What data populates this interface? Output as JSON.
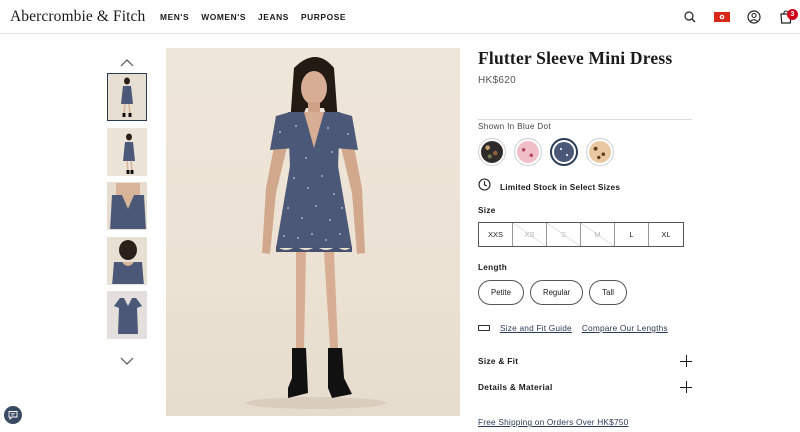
{
  "header": {
    "logo": "Abercrombie & Fitch",
    "nav": [
      "MEN'S",
      "WOMEN'S",
      "JEANS",
      "PURPOSE"
    ],
    "bag_count": "3"
  },
  "product": {
    "title": "Flutter Sleeve Mini Dress",
    "price": "HK$620",
    "shown_in": "Shown In Blue Dot",
    "selected_color": "Blue Dot",
    "stock_notice": "Limited Stock in Select Sizes",
    "size_label": "Size",
    "sizes": [
      {
        "label": "XXS",
        "available": true
      },
      {
        "label": "XS",
        "available": false
      },
      {
        "label": "S",
        "available": false
      },
      {
        "label": "M",
        "available": false
      },
      {
        "label": "L",
        "available": true
      },
      {
        "label": "XL",
        "available": true
      }
    ],
    "length_label": "Length",
    "lengths": [
      "Petite",
      "Regular",
      "Tall"
    ],
    "size_guide_link": "Size and Fit Guide",
    "compare_link": "Compare Our Lengths",
    "accordions": [
      "Size & Fit",
      "Details & Material"
    ],
    "shipping": "Free Shipping on Orders Over HK$750"
  },
  "colors": {
    "accent": "#2b3a55",
    "badge": "#d0021b",
    "dress": "#4b5877"
  }
}
